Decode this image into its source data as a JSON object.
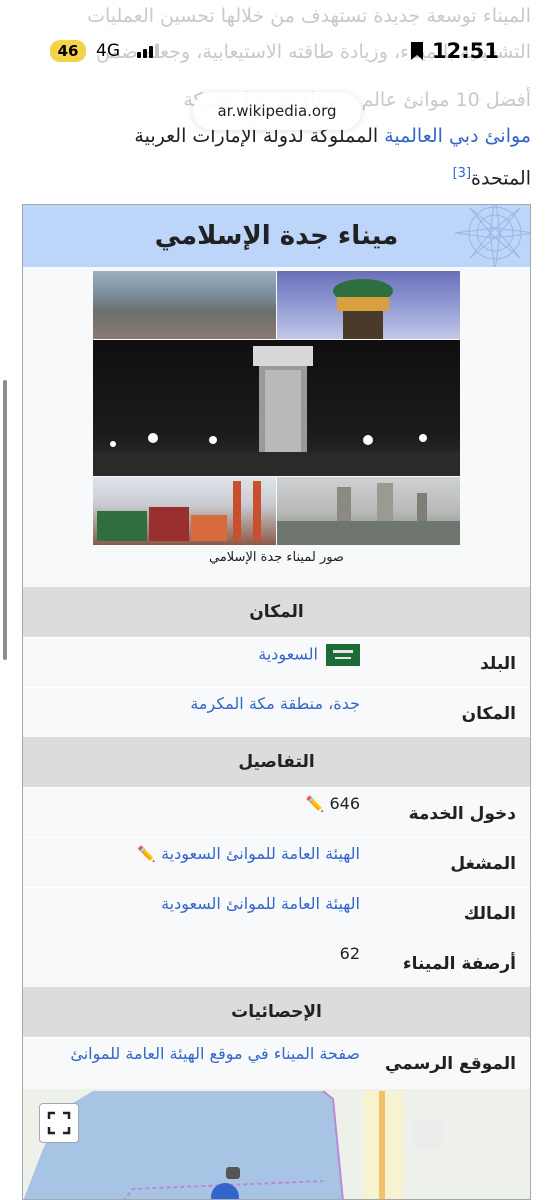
{
  "article": {
    "line1": "الميناء توسعة جديدة تستهدف من خلالها تحسين العمليات",
    "line2": "التشغيلية بالميناء، وزيادة طاقته الاستيعابية، وجعله ضمن",
    "line3": "أفضل 10 موانئ عالم... ميناء من قبل شركة",
    "line4_link": "موانئ دبي العالمية",
    "line4_text": " المملوكة لدولة الإمارات العربية",
    "line5": "المتحدة",
    "ref3": "[3]"
  },
  "status_bar": {
    "battery": "46",
    "network": "4G",
    "time": "12:51"
  },
  "url": "ar.wikipedia.org",
  "infobox": {
    "title": "ميناء جدة الإسلامي",
    "caption": "صور لميناء جدة الإسلامي",
    "section_location": "المكان",
    "country_label": "البلد",
    "country_value": "السعودية",
    "place_label": "المكان",
    "place_value": "جدة، منطقة مكة المكرمة",
    "section_details": "التفاصيل",
    "service_label": "دخول الخدمة",
    "service_value": "646",
    "operator_label": "المشغل",
    "operator_value": "الهيئة العامة للموانئ السعودية",
    "owner_label": "المالك",
    "owner_value": "الهيئة العامة للموانئ السعودية",
    "berths_label": "أرصفة الميناء",
    "berths_value": "62",
    "section_stats": "الإحصائيات",
    "website_label": "الموقع الرسمي",
    "website_value": "صفحة الميناء في موقع الهيئة العامة للموانئ"
  },
  "colors": {
    "link": "#3366cc",
    "title_bg": "#bcd5f8",
    "section_bg": "#dcdcdc",
    "battery_pill": "#f4d24a"
  },
  "icons": [
    "pencil-icon",
    "saudi-flag-icon",
    "compass-icon",
    "fullscreen-icon",
    "bookmark-icon",
    "signal-icon"
  ]
}
